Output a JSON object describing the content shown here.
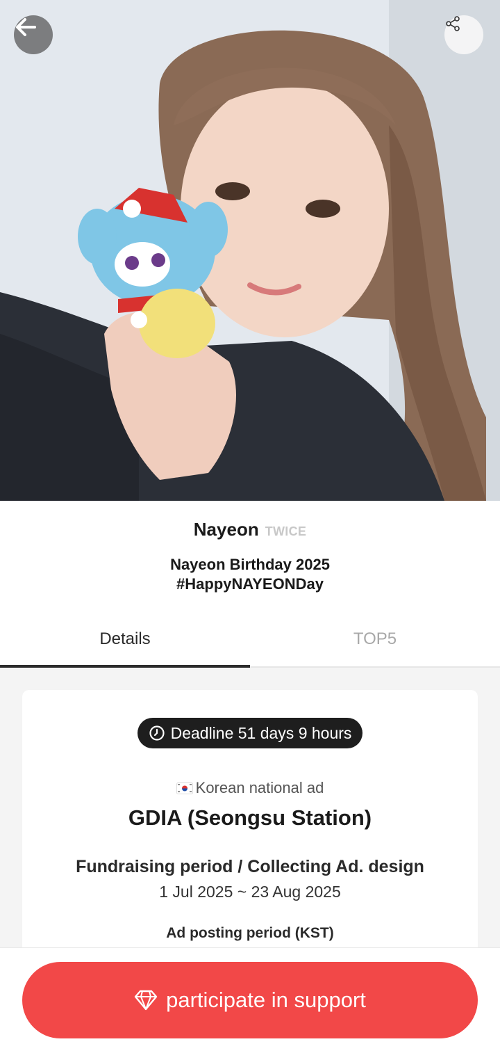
{
  "header": {
    "artist_name": "Nayeon",
    "group_name": "TWICE",
    "title_line1": "Nayeon Birthday 2025",
    "title_line2": "#HappyNAYEONDay"
  },
  "tabs": [
    {
      "label": "Details",
      "active": true
    },
    {
      "label": "TOP5",
      "active": false
    }
  ],
  "details": {
    "deadline": "Deadline 51 days 9 hours",
    "ad_type": "Korean national ad",
    "ad_location": "GDIA (Seongsu Station)",
    "period_title": "Fundraising period / Collecting Ad. design",
    "period_dates": "1 Jul 2025 ~ 23 Aug 2025",
    "posting_title": "Ad posting period (KST)"
  },
  "cta": {
    "label": "participate in support",
    "color": "#f24848"
  },
  "icons": {
    "back": "arrow-left-icon",
    "share": "share-icon",
    "clock": "clock-icon",
    "flag": "korea-flag-icon",
    "cta": "diamond-icon"
  }
}
